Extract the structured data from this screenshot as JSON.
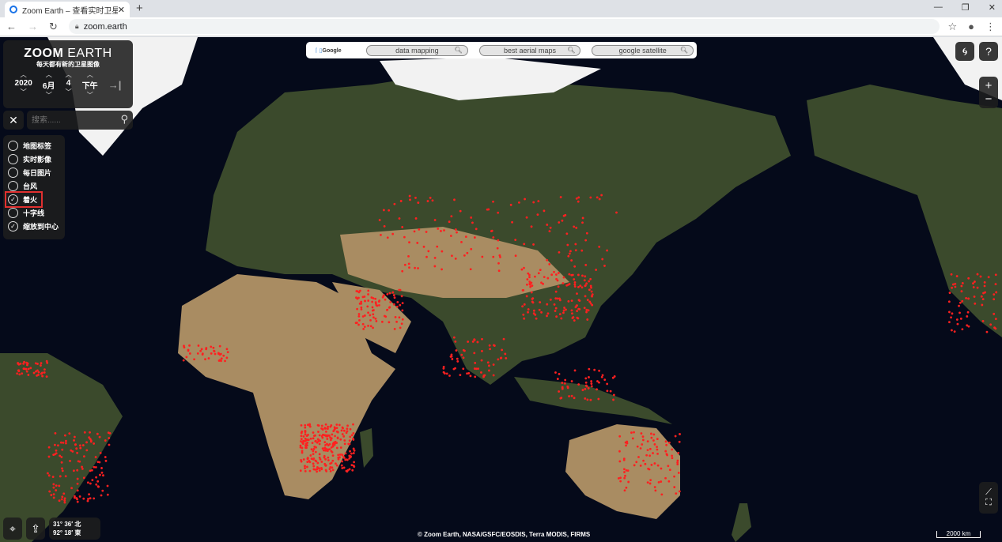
{
  "browser": {
    "tab_title": "Zoom Earth – 查看实时卫星图像",
    "url": "zoom.earth"
  },
  "logo": {
    "title_bold": "ZOOM",
    "title_light": "EARTH",
    "subtitle": "每天都有新的卫星图像"
  },
  "date": {
    "year": "2020",
    "month": "6月",
    "day": "4",
    "period": "下午"
  },
  "search": {
    "placeholder": "搜索......"
  },
  "layers": [
    {
      "label": "地图标签",
      "checked": false
    },
    {
      "label": "实时影像",
      "checked": false
    },
    {
      "label": "每日图片",
      "checked": false
    },
    {
      "label": "台风",
      "checked": false
    },
    {
      "label": "着火",
      "checked": true,
      "highlighted": true
    },
    {
      "label": "十字线",
      "checked": false
    },
    {
      "label": "缩放到中心",
      "checked": true
    }
  ],
  "ad_bar": {
    "brand": "Google",
    "queries": [
      "data mapping",
      "best aerial maps",
      "google satellite"
    ]
  },
  "coordinates": {
    "lat": "31° 36′ 北",
    "lon": "92° 18′ 東"
  },
  "attribution": "© Zoom Earth, NASA/GSFC/EOSDIS, Terra MODIS, FIRMS",
  "scale": "2000 km",
  "colors": {
    "fire": "#ff2020",
    "ocean": "#050a1a",
    "panel": "#1e1e1e",
    "highlight": "#e03030"
  }
}
